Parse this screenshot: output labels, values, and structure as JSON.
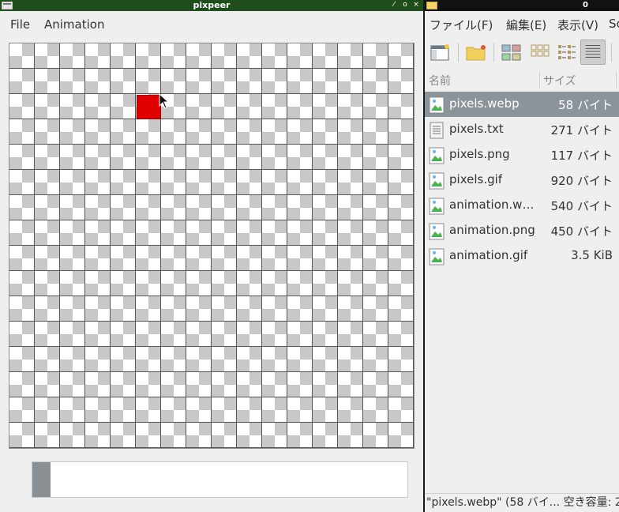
{
  "pixpeer": {
    "title": "pixpeer",
    "title_buttons": [
      "⁄",
      "o",
      "×"
    ],
    "menu": [
      "File",
      "Animation"
    ],
    "canvas": {
      "grid_columns": 16,
      "grid_rows": 16
    },
    "painted_cell": {
      "column": 6,
      "row": 3,
      "color": "#e00000"
    },
    "current_color": "#8a8f94"
  },
  "file_manager": {
    "title": "0",
    "menu": [
      "ファイル(F)",
      "編集(E)",
      "表示(V)",
      "Sc"
    ],
    "toolbar": [
      {
        "icon": "window-icon"
      },
      {
        "icon": "new-folder-icon"
      },
      {
        "icon": "thumbnail-view-icon"
      },
      {
        "icon": "icon-view-icon"
      },
      {
        "icon": "compact-view-icon"
      },
      {
        "icon": "detail-view-icon",
        "active": true
      }
    ],
    "columns": {
      "name": "名前",
      "size": "サイズ"
    },
    "files": [
      {
        "name": "pixels.webp",
        "size": "58 バイト",
        "type": "image",
        "selected": true
      },
      {
        "name": "pixels.txt",
        "size": "271 バイト",
        "type": "text"
      },
      {
        "name": "pixels.png",
        "size": "117 バイト",
        "type": "image"
      },
      {
        "name": "pixels.gif",
        "size": "920 バイト",
        "type": "image"
      },
      {
        "name": "animation.we…",
        "size": "540 バイト",
        "type": "image"
      },
      {
        "name": "animation.png",
        "size": "450 バイト",
        "type": "image"
      },
      {
        "name": "animation.gif",
        "size": "3.5 KiB",
        "type": "image"
      }
    ],
    "status": "\"pixels.webp\" (58 バイ... 空き容量: 2"
  }
}
